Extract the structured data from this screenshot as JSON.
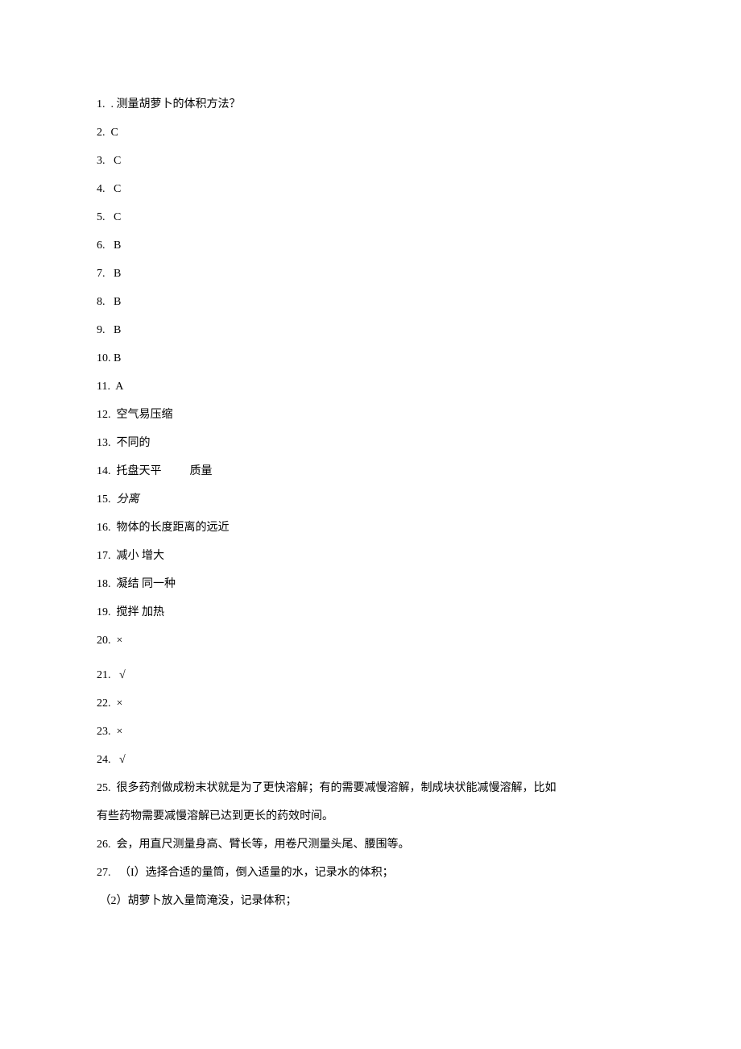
{
  "answers": [
    {
      "num": "1.",
      "sep": "  ",
      "text": ". 测量胡萝卜的体积方法？"
    },
    {
      "num": "2.",
      "sep": "  ",
      "text": "C"
    },
    {
      "num": "3.",
      "sep": "   ",
      "text": "C"
    },
    {
      "num": "4.",
      "sep": "   ",
      "text": "C"
    },
    {
      "num": "5.",
      "sep": "   ",
      "text": "C"
    },
    {
      "num": "6.",
      "sep": "   ",
      "text": "B"
    },
    {
      "num": "7.",
      "sep": "   ",
      "text": "B"
    },
    {
      "num": "8.",
      "sep": "   ",
      "text": "B"
    },
    {
      "num": "9.",
      "sep": "   ",
      "text": "B"
    },
    {
      "num": "10.",
      "sep": " ",
      "text": "B"
    },
    {
      "num": "11.",
      "sep": "  ",
      "text": "A"
    },
    {
      "num": "12.",
      "sep": "  ",
      "text": "空气易压缩"
    },
    {
      "num": "13.",
      "sep": "  ",
      "text": "不同的"
    },
    {
      "num": "14.",
      "sep": "  ",
      "text": "托盘天平          质量"
    },
    {
      "num": "15.",
      "sep": "  ",
      "text": "分离",
      "italic": true
    },
    {
      "num": "16.",
      "sep": "  ",
      "text": "物体的长度距离的远近"
    },
    {
      "num": "17.",
      "sep": "  ",
      "text": "减小 增大"
    },
    {
      "num": "18.",
      "sep": "  ",
      "text": "凝结 同一种"
    },
    {
      "num": "19.",
      "sep": "  ",
      "text": "搅拌 加热"
    },
    {
      "num": "20.",
      "sep": "  ",
      "text": "×"
    },
    {
      "num": "21.",
      "sep": "   ",
      "text": "√",
      "gap": true
    },
    {
      "num": "22.",
      "sep": "  ",
      "text": "×"
    },
    {
      "num": "23.",
      "sep": "  ",
      "text": "×"
    },
    {
      "num": "24.",
      "sep": "   ",
      "text": "√"
    },
    {
      "num": "25.",
      "sep": "  ",
      "text": "很多药剂做成粉末状就是为了更快溶解；有的需要减慢溶解，制成块状能减慢溶解，比如"
    },
    {
      "num": "",
      "sep": "",
      "text": "有些药物需要减慢溶解已达到更长的药效时间。"
    },
    {
      "num": "26.",
      "sep": "  ",
      "text": "会，用直尺测量身高、臂长等，用卷尺测量头尾、腰围等。"
    },
    {
      "num": "27.",
      "sep": "   ",
      "text": "（I）选择合适的量筒，倒入适量的水，记录水的体积；"
    },
    {
      "num": "",
      "sep": " ",
      "text": "（2）胡萝卜放入量筒淹没，记录体积；"
    }
  ]
}
